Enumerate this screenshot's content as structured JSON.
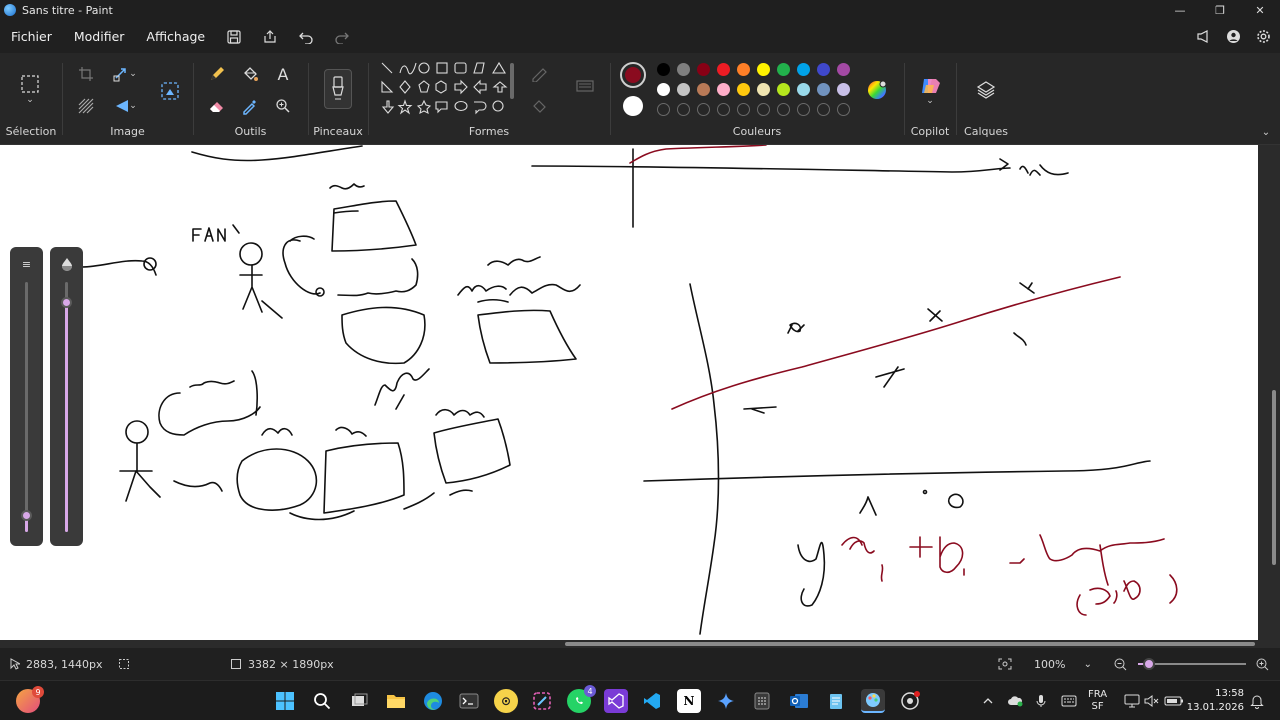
{
  "window": {
    "title": "Sans titre - Paint",
    "minimize": "—",
    "maximize": "❐",
    "close": "✕"
  },
  "menu": {
    "file": "Fichier",
    "edit": "Modifier",
    "view": "Affichage"
  },
  "ribbon": {
    "selection": "Sélection",
    "image": "Image",
    "tools": "Outils",
    "brushes": "Pinceaux",
    "shapes": "Formes",
    "colors": "Couleurs",
    "copilot": "Copilot",
    "layers": "Calques"
  },
  "colors": {
    "primary": "#8a0b1f",
    "secondary": "#ffffff",
    "palette_row1": [
      "#000000",
      "#7f7f7f",
      "#880015",
      "#ed1c24",
      "#ff7f27",
      "#fff200",
      "#22b14c",
      "#00a2e8",
      "#3f48cc",
      "#a349a4"
    ],
    "palette_row2": [
      "#ffffff",
      "#c3c3c3",
      "#b97a57",
      "#ffaec9",
      "#ffc90e",
      "#efe4b0",
      "#b5e61d",
      "#99d9ea",
      "#7092be",
      "#c8bfe7"
    ]
  },
  "status": {
    "cursor_pos": "2883, 1440px",
    "canvas_size": "3382 × 1890px",
    "zoom": "100%",
    "zoom_slider_level": 0.1
  },
  "sliders": {
    "size_level": 0.07,
    "opacity_level": 0.92
  },
  "taskbar": {
    "badge_left": "9",
    "whatsapp_badge": "4",
    "lang": "FRA",
    "lang_sub": "SF",
    "time": "13:58",
    "date": "13.01.2026"
  }
}
